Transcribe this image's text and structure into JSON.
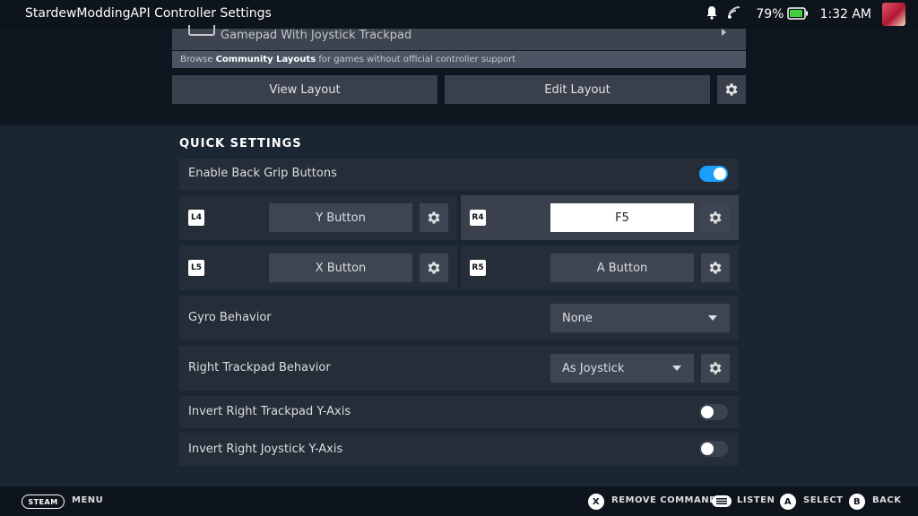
{
  "header": {
    "title": "StardewModdingAPI Controller Settings",
    "battery_pct": "79%",
    "time": "1:32 AM"
  },
  "layout": {
    "current_name": "Gamepad With Joystick Trackpad",
    "browse_prefix": "Browse ",
    "browse_link": "Community Layouts",
    "browse_suffix": " for games without official controller support",
    "view_label": "View Layout",
    "edit_label": "Edit Layout"
  },
  "quick_settings": {
    "title": "QUICK SETTINGS",
    "back_grip_label": "Enable Back Grip Buttons",
    "back_grip_enabled": true,
    "grips": {
      "l4": {
        "badge": "L4",
        "binding": "Y Button"
      },
      "r4": {
        "badge": "R4",
        "binding": "F5"
      },
      "l5": {
        "badge": "L5",
        "binding": "X Button"
      },
      "r5": {
        "badge": "R5",
        "binding": "A Button"
      }
    },
    "gyro": {
      "label": "Gyro Behavior",
      "value": "None"
    },
    "right_trackpad": {
      "label": "Right Trackpad Behavior",
      "value": "As Joystick"
    },
    "invert_trackpad": {
      "label": "Invert Right Trackpad Y-Axis",
      "enabled": false
    },
    "invert_joystick": {
      "label": "Invert Right Joystick Y-Axis",
      "enabled": false
    }
  },
  "footer": {
    "steam": "STEAM",
    "menu": "MENU",
    "x_glyph": "X",
    "remove": "REMOVE COMMAND",
    "listen": "LISTEN",
    "a_glyph": "A",
    "select": "SELECT",
    "b_glyph": "B",
    "back": "BACK"
  },
  "colors": {
    "accent": "#1a9fff",
    "background": "#1b2633",
    "topbar": "#0e141b"
  }
}
